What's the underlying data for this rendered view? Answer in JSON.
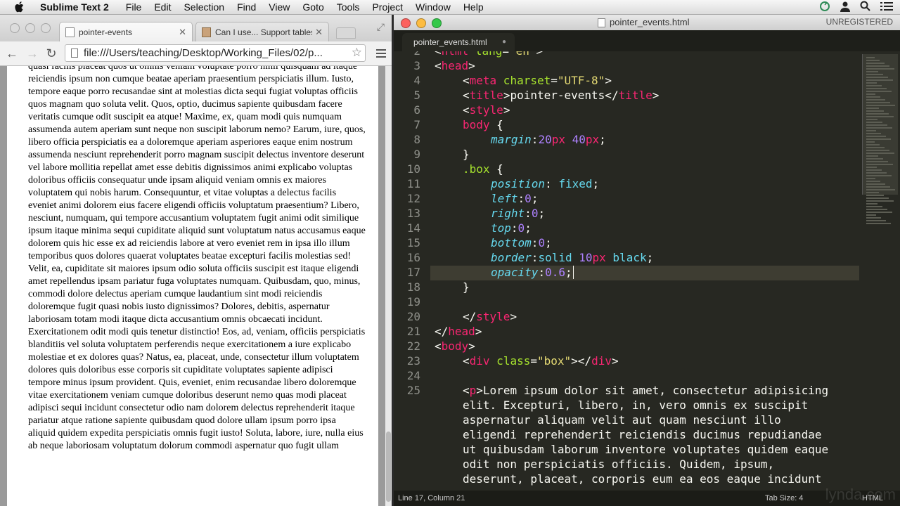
{
  "menubar": {
    "app_name": "Sublime Text 2",
    "items": [
      "File",
      "Edit",
      "Selection",
      "Find",
      "View",
      "Goto",
      "Tools",
      "Project",
      "Window",
      "Help"
    ]
  },
  "browser": {
    "tabs": [
      {
        "label": "pointer-events",
        "active": true
      },
      {
        "label": "Can I use... Support tables",
        "active": false
      }
    ],
    "url": "file:///Users/teaching/Desktop/Working_Files/02/p...",
    "page_text": "quasi facilis placeat quos ut omnis veniam voluptate porro nihil quisquam ad itaque reiciendis ipsum non cumque beatae aperiam praesentium perspiciatis illum. Iusto, tempore eaque porro recusandae sint at molestias dicta sequi fugiat voluptas officiis quos magnam quo soluta velit. Quos, optio, ducimus sapiente quibusdam facere veritatis cumque odit suscipit ea atque! Maxime, ex, quam modi quis numquam assumenda autem aperiam sunt neque non suscipit laborum nemo? Earum, iure, quos, libero officia perspiciatis ea a doloremque aperiam asperiores eaque enim nostrum assumenda nesciunt reprehenderit porro magnam suscipit delectus inventore deserunt vel labore mollitia repellat amet esse debitis dignissimos animi explicabo voluptas doloribus officiis consequatur unde ipsam aliquid veniam omnis ex maiores voluptatem qui nobis harum. Consequuntur, et vitae voluptas a delectus facilis eveniet animi dolorem eius facere eligendi officiis voluptatum praesentium? Libero, nesciunt, numquam, qui tempore accusantium voluptatem fugit animi odit similique ipsum itaque minima sequi cupiditate aliquid sunt voluptatum natus accusamus eaque dolorem quis hic esse ex ad reiciendis labore at vero eveniet rem in ipsa illo illum temporibus quos dolores quaerat voluptates beatae excepturi facilis molestias sed! Velit, ea, cupiditate sit maiores ipsum odio soluta officiis suscipit est itaque eligendi amet repellendus ipsam pariatur fuga voluptates numquam. Quibusdam, quo, minus, commodi dolore delectus aperiam cumque laudantium sint modi reiciendis doloremque fugit quasi nobis iusto dignissimos? Dolores, debitis, aspernatur laboriosam totam modi itaque dicta accusantium omnis obcaecati incidunt. Exercitationem odit modi quis tenetur distinctio! Eos, ad, veniam, officiis perspiciatis blanditiis vel soluta voluptatem perferendis neque exercitationem a iure explicabo molestiae et ex dolores quas? Natus, ea, placeat, unde, consectetur illum voluptatem dolores quis doloribus esse corporis sit cupiditate voluptates sapiente adipisci tempore minus ipsum provident. Quis, eveniet, enim recusandae libero doloremque vitae exercitationem veniam cumque doloribus deserunt nemo quas modi placeat adipisci sequi incidunt consectetur odio nam dolorem delectus reprehenderit itaque pariatur atque ratione sapiente quibusdam quod dolore ullam ipsum porro ipsa aliquid quidem expedita perspiciatis omnis fugit iusto! Soluta, labore, iure, nulla eius ab neque laboriosam voluptatum dolorum commodi aspernatur quo fugit ullam"
  },
  "editor": {
    "window_title": "pointer_events.html",
    "license": "UNREGISTERED",
    "tab_label": "pointer_events.html",
    "current_line": 17,
    "lines": [
      {
        "n": "2",
        "parts": [
          [
            "<",
            "plain"
          ],
          [
            "html",
            "tg"
          ],
          [
            " lang",
            "at"
          ],
          [
            "=",
            "plain"
          ],
          [
            "\"en\"",
            "st"
          ],
          [
            ">",
            "plain"
          ]
        ],
        "indent": 0
      },
      {
        "n": "3",
        "parts": [
          [
            "<",
            "plain"
          ],
          [
            "head",
            "tg"
          ],
          [
            ">",
            "plain"
          ]
        ],
        "indent": 0
      },
      {
        "n": "4",
        "parts": [
          [
            "<",
            "plain"
          ],
          [
            "meta",
            "tg"
          ],
          [
            " charset",
            "at"
          ],
          [
            "=",
            "plain"
          ],
          [
            "\"UTF-8\"",
            "st"
          ],
          [
            ">",
            "plain"
          ]
        ],
        "indent": 1
      },
      {
        "n": "5",
        "parts": [
          [
            "<",
            "plain"
          ],
          [
            "title",
            "tg"
          ],
          [
            ">pointer-events</",
            "plain"
          ],
          [
            "title",
            "tg"
          ],
          [
            ">",
            "plain"
          ]
        ],
        "indent": 1
      },
      {
        "n": "6",
        "parts": [
          [
            "<",
            "plain"
          ],
          [
            "style",
            "tg"
          ],
          [
            ">",
            "plain"
          ]
        ],
        "indent": 1
      },
      {
        "n": "7",
        "parts": [
          [
            "body",
            "tg"
          ],
          [
            " {",
            "plain"
          ]
        ],
        "indent": 1
      },
      {
        "n": "8",
        "parts": [
          [
            "margin",
            "pr"
          ],
          [
            ":",
            "plain"
          ],
          [
            "20",
            "nm"
          ],
          [
            "px",
            "tg"
          ],
          [
            " ",
            "plain"
          ],
          [
            "40",
            "nm"
          ],
          [
            "px",
            "tg"
          ],
          [
            ";",
            "plain"
          ]
        ],
        "indent": 2
      },
      {
        "n": "9",
        "parts": [
          [
            "}",
            "plain"
          ]
        ],
        "indent": 1
      },
      {
        "n": "10",
        "parts": [
          [
            ".box",
            "at"
          ],
          [
            " {",
            "plain"
          ]
        ],
        "indent": 1
      },
      {
        "n": "11",
        "parts": [
          [
            "position",
            "pr"
          ],
          [
            ": ",
            "plain"
          ],
          [
            "fixed",
            "kw"
          ],
          [
            ";",
            "plain"
          ]
        ],
        "indent": 2
      },
      {
        "n": "12",
        "parts": [
          [
            "left",
            "pr"
          ],
          [
            ":",
            "plain"
          ],
          [
            "0",
            "nm"
          ],
          [
            ";",
            "plain"
          ]
        ],
        "indent": 2
      },
      {
        "n": "13",
        "parts": [
          [
            "right",
            "pr"
          ],
          [
            ":",
            "plain"
          ],
          [
            "0",
            "nm"
          ],
          [
            ";",
            "plain"
          ]
        ],
        "indent": 2
      },
      {
        "n": "14",
        "parts": [
          [
            "top",
            "pr"
          ],
          [
            ":",
            "plain"
          ],
          [
            "0",
            "nm"
          ],
          [
            ";",
            "plain"
          ]
        ],
        "indent": 2
      },
      {
        "n": "15",
        "parts": [
          [
            "bottom",
            "pr"
          ],
          [
            ":",
            "plain"
          ],
          [
            "0",
            "nm"
          ],
          [
            ";",
            "plain"
          ]
        ],
        "indent": 2
      },
      {
        "n": "16",
        "parts": [
          [
            "border",
            "pr"
          ],
          [
            ":",
            "plain"
          ],
          [
            "solid",
            "kw"
          ],
          [
            " ",
            "plain"
          ],
          [
            "10",
            "nm"
          ],
          [
            "px",
            "tg"
          ],
          [
            " ",
            "plain"
          ],
          [
            "black",
            "kw"
          ],
          [
            ";",
            "plain"
          ]
        ],
        "indent": 2
      },
      {
        "n": "17",
        "parts": [
          [
            "opacity",
            "pr"
          ],
          [
            ":",
            "plain"
          ],
          [
            "0.6",
            "nm"
          ],
          [
            ";",
            "plain"
          ]
        ],
        "indent": 2
      },
      {
        "n": "18",
        "parts": [
          [
            "}",
            "plain"
          ]
        ],
        "indent": 1
      },
      {
        "n": "19",
        "parts": [],
        "indent": 0
      },
      {
        "n": "20",
        "parts": [
          [
            "</",
            "plain"
          ],
          [
            "style",
            "tg"
          ],
          [
            ">",
            "plain"
          ]
        ],
        "indent": 1
      },
      {
        "n": "21",
        "parts": [
          [
            "</",
            "plain"
          ],
          [
            "head",
            "tg"
          ],
          [
            ">",
            "plain"
          ]
        ],
        "indent": 0
      },
      {
        "n": "22",
        "parts": [
          [
            "<",
            "plain"
          ],
          [
            "body",
            "tg"
          ],
          [
            ">",
            "plain"
          ]
        ],
        "indent": 0
      },
      {
        "n": "23",
        "parts": [
          [
            "<",
            "plain"
          ],
          [
            "div",
            "tg"
          ],
          [
            " class",
            "at"
          ],
          [
            "=",
            "plain"
          ],
          [
            "\"box\"",
            "st"
          ],
          [
            "></",
            "plain"
          ],
          [
            "div",
            "tg"
          ],
          [
            ">",
            "plain"
          ]
        ],
        "indent": 1
      },
      {
        "n": "24",
        "parts": [],
        "indent": 0
      },
      {
        "n": "25",
        "parts": [
          [
            "<",
            "plain"
          ],
          [
            "p",
            "tg"
          ],
          [
            ">Lorem ipsum dolor sit amet, consectetur adipisicing",
            "plain"
          ]
        ],
        "indent": 1
      },
      {
        "n": "",
        "parts": [
          [
            "elit. Excepturi, libero, in, vero omnis ex suscipit",
            "plain"
          ]
        ],
        "indent": 1
      },
      {
        "n": "",
        "parts": [
          [
            "aspernatur aliquam velit aut quam nesciunt illo",
            "plain"
          ]
        ],
        "indent": 1
      },
      {
        "n": "",
        "parts": [
          [
            "eligendi reprehenderit reiciendis ducimus repudiandae",
            "plain"
          ]
        ],
        "indent": 1
      },
      {
        "n": "",
        "parts": [
          [
            "ut quibusdam laborum inventore voluptates quidem eaque",
            "plain"
          ]
        ],
        "indent": 1
      },
      {
        "n": "",
        "parts": [
          [
            "odit non perspiciatis officiis. Quidem, ipsum,",
            "plain"
          ]
        ],
        "indent": 1
      },
      {
        "n": "",
        "parts": [
          [
            "deserunt, placeat, corporis eum ea eos eaque incidunt",
            "plain"
          ]
        ],
        "indent": 1
      }
    ]
  },
  "statusbar": {
    "position": "Line 17, Column 21",
    "tab_size": "Tab Size: 4",
    "syntax": "HTML"
  },
  "watermark": "lynda.com"
}
